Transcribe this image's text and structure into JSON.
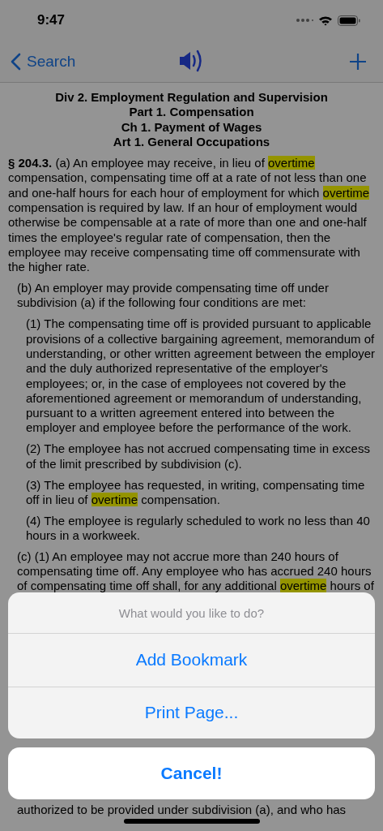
{
  "status_bar": {
    "time": "9:47"
  },
  "nav_bar": {
    "back_label": "Search"
  },
  "headings": [
    "Div 2. Employment Regulation and Supervision",
    "Part 1. Compensation",
    "Ch 1. Payment of Wages",
    "Art 1. General Occupations"
  ],
  "paragraphs": [
    {
      "kind": "section",
      "lines": [
        [
          {
            "text": "**§ 204.3.** (a) An employee may receive, in lieu of ",
            "highlight": false
          },
          {
            "text": "overtime",
            "highlight": true
          }
        ],
        [
          {
            "text": "compensation, compensating time off at a rate of not less than one",
            "highlight": false
          }
        ],
        [
          {
            "text": "and one-half hours for each hour of employment for which ",
            "highlight": false
          },
          {
            "text": "overtime",
            "highlight": true
          }
        ],
        [
          {
            "text": "compensation is required by law. If an hour of employment would",
            "highlight": false
          }
        ],
        [
          {
            "text": "otherwise be compensable at a rate of more than one and one-half",
            "highlight": false
          }
        ],
        [
          {
            "text": "times the employee's regular rate of compensation, then the",
            "highlight": false
          }
        ],
        [
          {
            "text": "employee may receive compensating time off commensurate with",
            "highlight": false
          }
        ],
        [
          {
            "text": "the higher rate.",
            "highlight": false
          }
        ]
      ]
    },
    {
      "kind": "subdivision",
      "lines": [
        [
          {
            "text": "(b) An employer may provide compensating time off under",
            "highlight": false
          }
        ],
        [
          {
            "text": "subdivision (a) if the following four conditions are met:",
            "highlight": false
          }
        ]
      ]
    },
    {
      "kind": "paragraph",
      "lines": [
        [
          {
            "text": "(1) The compensating time off is provided pursuant to applicable",
            "highlight": false
          }
        ],
        [
          {
            "text": "provisions of a collective bargaining agreement, memorandum of",
            "highlight": false
          }
        ],
        [
          {
            "text": "understanding, or other written agreement between the employer",
            "highlight": false
          }
        ],
        [
          {
            "text": "and the duly authorized representative of the employer's",
            "highlight": false
          }
        ],
        [
          {
            "text": "employees; or, in the case of employees not covered by the",
            "highlight": false
          }
        ],
        [
          {
            "text": "aforementioned agreement or memorandum of understanding,",
            "highlight": false
          }
        ],
        [
          {
            "text": "pursuant to a written agreement entered into between the",
            "highlight": false
          }
        ],
        [
          {
            "text": "employer and employee before the performance of the work.",
            "highlight": false
          }
        ]
      ]
    },
    {
      "kind": "paragraph",
      "lines": [
        [
          {
            "text": "(2) The employee has not accrued compensating time in excess",
            "highlight": false
          }
        ],
        [
          {
            "text": "of the limit prescribed by subdivision (c).",
            "highlight": false
          }
        ]
      ]
    },
    {
      "kind": "paragraph",
      "lines": [
        [
          {
            "text": "(3) The employee has requested, in writing, compensating time",
            "highlight": false
          }
        ],
        [
          {
            "text": "off in lieu of ",
            "highlight": false
          },
          {
            "text": "overtime",
            "highlight": true
          },
          {
            "text": " compensation.",
            "highlight": false
          }
        ]
      ]
    },
    {
      "kind": "paragraph",
      "lines": [
        [
          {
            "text": "(4) The employee is regularly scheduled to work no less than 40",
            "highlight": false
          }
        ],
        [
          {
            "text": "hours in a workweek.",
            "highlight": false
          }
        ]
      ]
    },
    {
      "kind": "subdivision",
      "lines": [
        [
          {
            "text": "(c) (1) An employee may not accrue more than 240 hours of",
            "highlight": false
          }
        ],
        [
          {
            "text": "compensating time off. Any employee who has accrued 240 hours",
            "highlight": false
          }
        ],
        [
          {
            "text": "of compensating time off shall, for any additional ",
            "highlight": false
          },
          {
            "text": "overtime",
            "highlight": true
          },
          {
            "text": " hours of",
            "highlight": false
          }
        ]
      ]
    }
  ],
  "lower_lines": [
    "authorized to be provided under subdivision (a), and who has"
  ],
  "action_sheet": {
    "title": "What would you like to do?",
    "actions": [
      "Add Bookmark",
      "Print Page..."
    ],
    "cancel": "Cancel!"
  }
}
